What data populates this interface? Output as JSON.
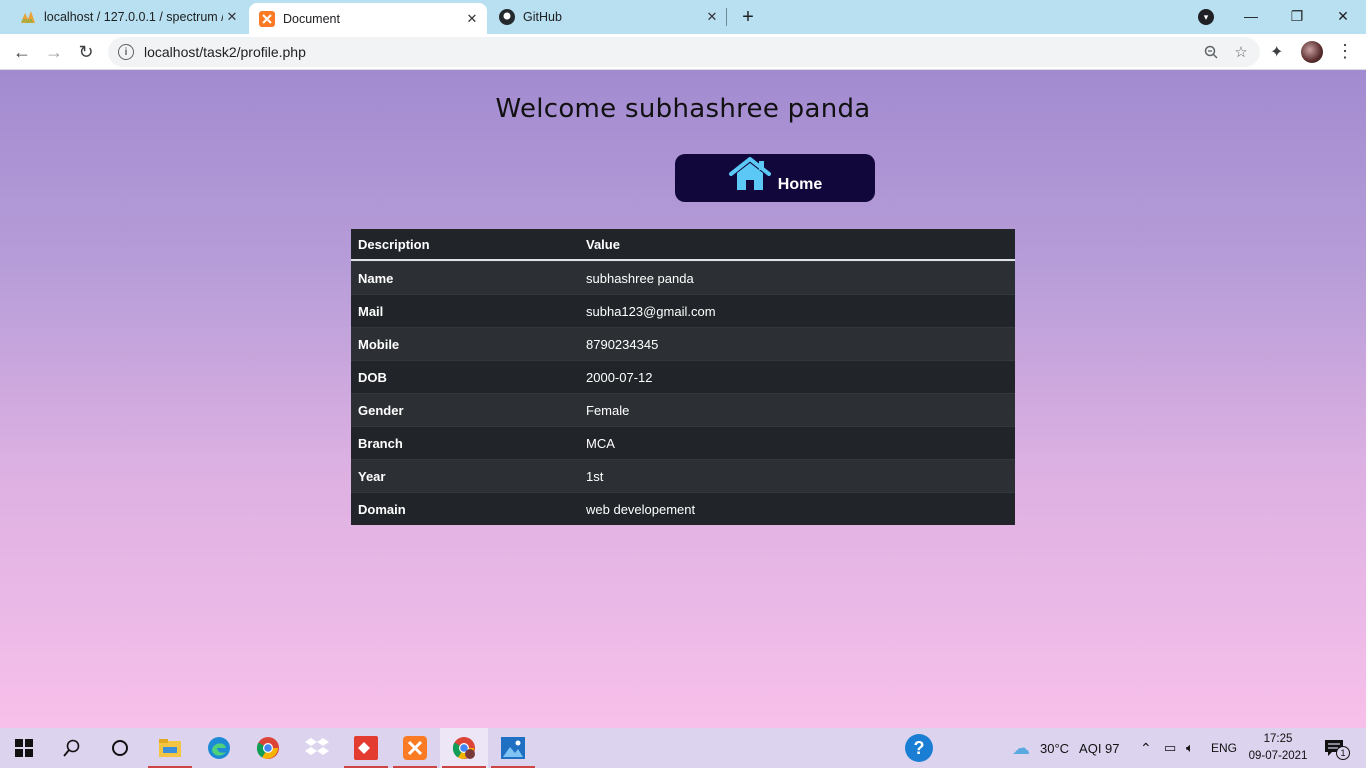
{
  "browser": {
    "tabs": [
      {
        "title": "localhost / 127.0.0.1 / spectrum /",
        "icon": "phpmyadmin-icon"
      },
      {
        "title": "Document",
        "icon": "xampp-icon"
      },
      {
        "title": "GitHub",
        "icon": "github-icon"
      }
    ],
    "url": "localhost/task2/profile.php"
  },
  "page": {
    "welcome": "Welcome subhashree panda",
    "home_label": "Home",
    "table": {
      "headers": [
        "Description",
        "Value"
      ],
      "rows": [
        [
          "Name",
          "subhashree panda"
        ],
        [
          "Mail",
          "subha123@gmail.com"
        ],
        [
          "Mobile",
          "8790234345"
        ],
        [
          "DOB",
          "2000-07-12"
        ],
        [
          "Gender",
          "Female"
        ],
        [
          "Branch",
          "MCA"
        ],
        [
          "Year",
          "1st"
        ],
        [
          "Domain",
          "web developement"
        ]
      ]
    },
    "colors": {
      "home_bg": "#12073a",
      "home_icon": "#5bc8f5",
      "table_bg": "#212529"
    }
  },
  "taskbar": {
    "weather": "30°C",
    "aqi": "AQI 97",
    "lang": "ENG",
    "time": "17:25",
    "date": "09-07-2021",
    "notification_count": "1"
  }
}
